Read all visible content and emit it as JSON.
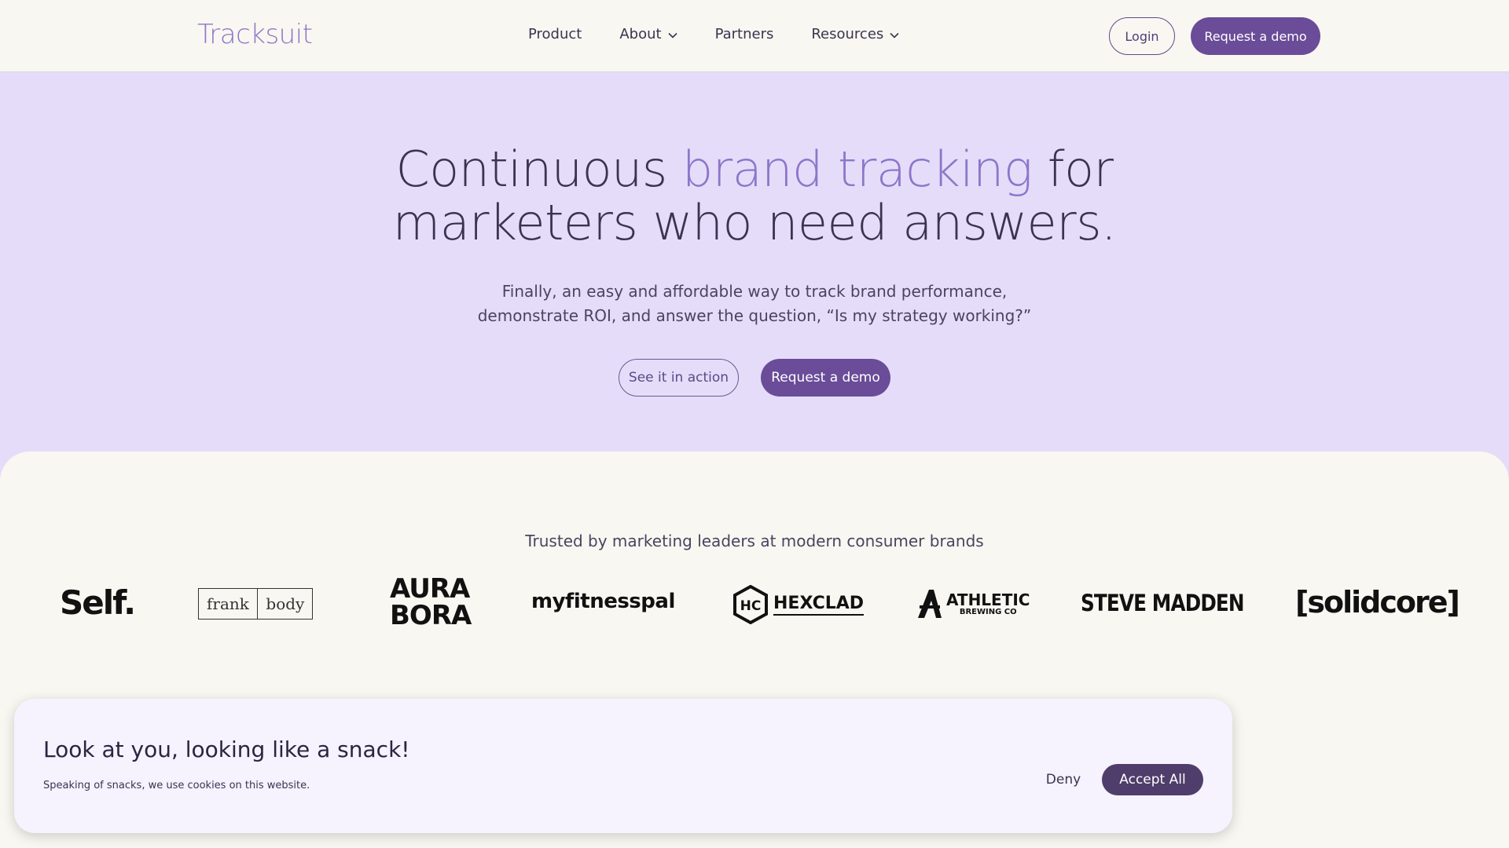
{
  "header": {
    "logo": "Tracksuit",
    "nav": [
      {
        "label": "Product",
        "has_dropdown": false
      },
      {
        "label": "About",
        "has_dropdown": true
      },
      {
        "label": "Partners",
        "has_dropdown": false
      },
      {
        "label": "Resources",
        "has_dropdown": true
      }
    ],
    "login_label": "Login",
    "demo_label": "Request a demo"
  },
  "hero": {
    "title_part1": "Continuous ",
    "title_accent": "brand tracking",
    "title_part2": " for",
    "title_line2": "marketers who need answers.",
    "subtitle_line1": "Finally, an easy and affordable way to track brand performance,",
    "subtitle_line2": "demonstrate ROI, and answer the question, “Is my strategy working?”",
    "action_label": "See it in action",
    "demo_label": "Request a demo"
  },
  "brands": {
    "heading": "Trusted by marketing leaders at modern consumer brands",
    "logos": {
      "self": "Self.",
      "frank": "frank",
      "body": "body",
      "aura": "AURA",
      "bora": "BORA",
      "mfp": "myfitnesspal",
      "hexclad": "HEXCLAD",
      "athletic": "ATHLETIC",
      "brewing": "BREWING CO",
      "steve": "STEVE MADDEN",
      "solid": "[solidcore]"
    }
  },
  "cookie": {
    "title": "Look at you, looking like a snack!",
    "text": "Speaking of snacks, we use cookies on this website.",
    "deny_label": "Deny",
    "accept_label": "Accept All"
  },
  "colors": {
    "accent": "#8d76c9",
    "primary_button": "#6a4c98",
    "hero_bg": "#e5dcfa",
    "page_bg": "#f9f7f1"
  }
}
